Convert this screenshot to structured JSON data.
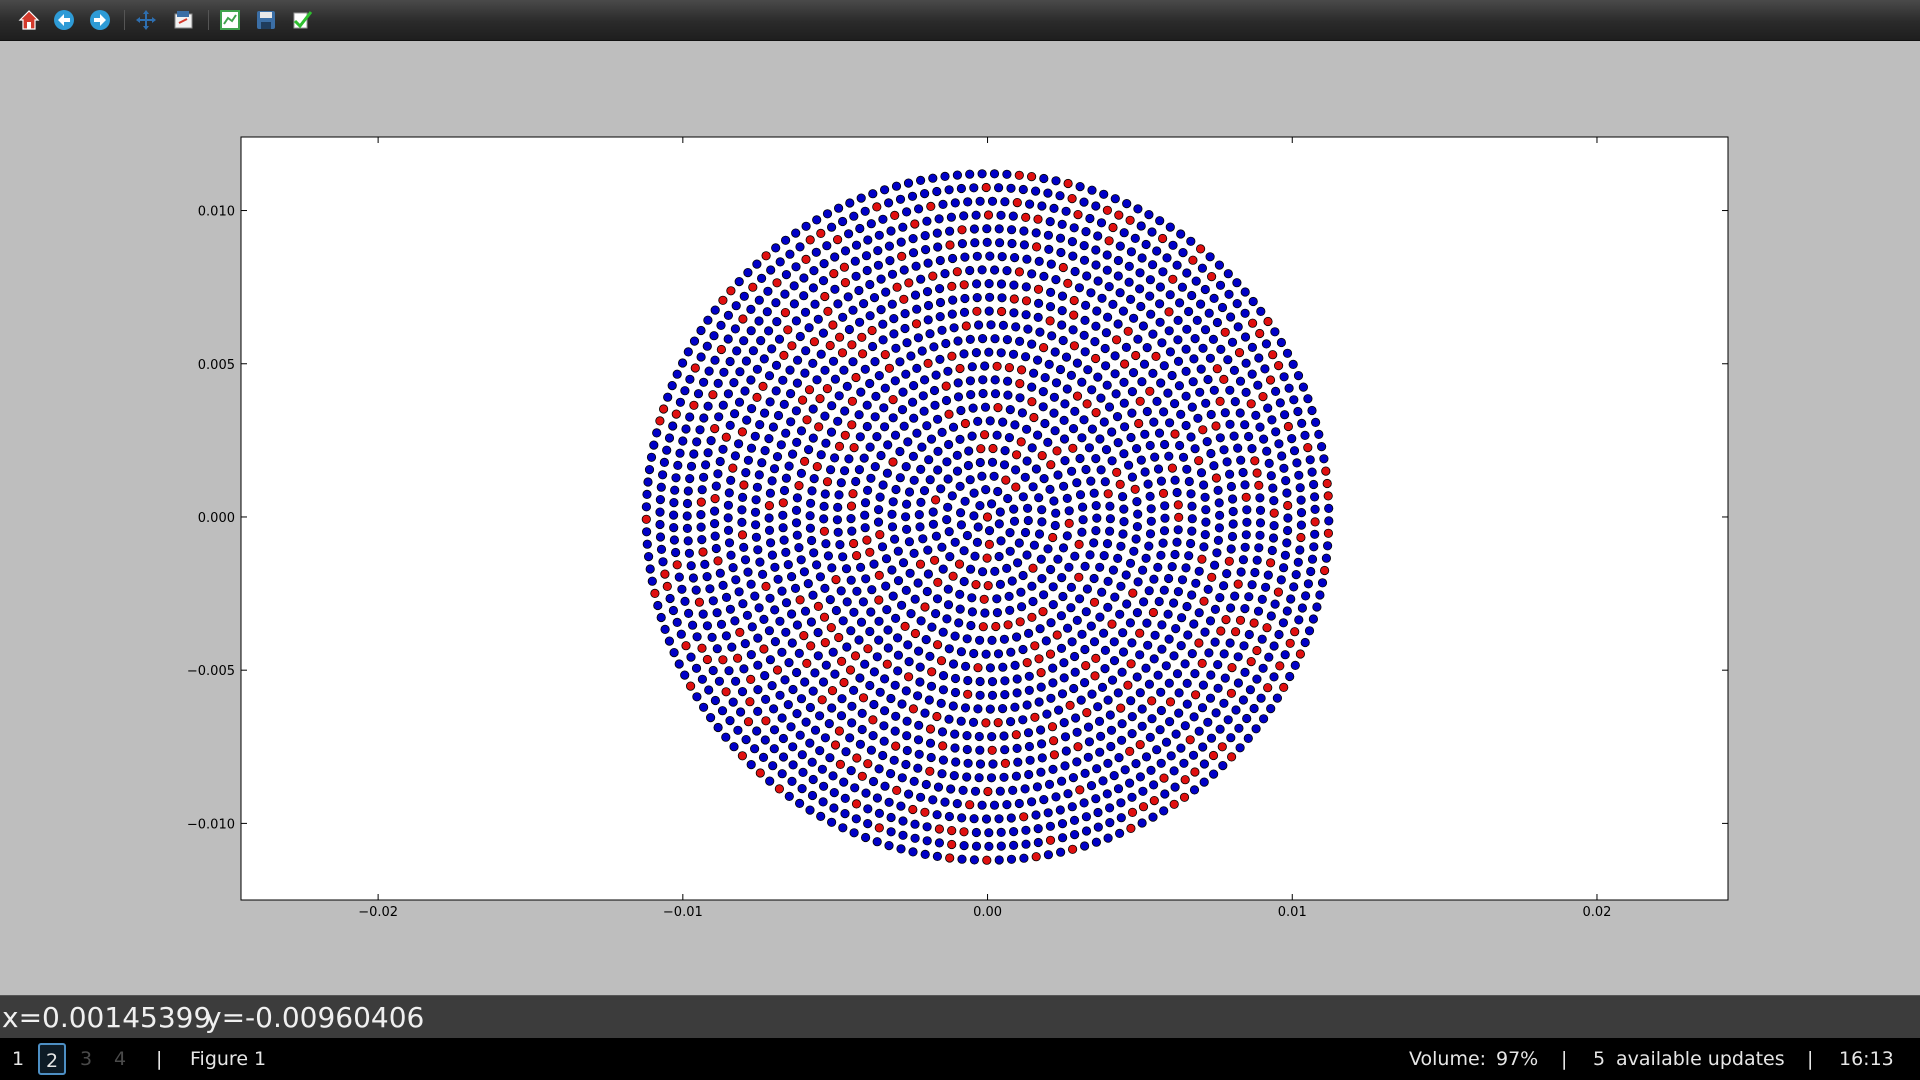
{
  "toolbar": {
    "buttons": [
      {
        "name": "home-icon",
        "color": "#d33a2c"
      },
      {
        "name": "back-arrow-icon",
        "color": "#2e9bd6"
      },
      {
        "name": "forward-arrow-icon",
        "color": "#2e9bd6"
      },
      {
        "name": "pan-icon",
        "color": "#2e6fb0"
      },
      {
        "name": "zoom-to-rect-icon",
        "color": "#e0e0e0"
      },
      {
        "name": "configure-subplots-icon",
        "color": "#3fa34d"
      },
      {
        "name": "save-icon",
        "color": "#3b6ea5"
      },
      {
        "name": "edit-check-icon",
        "color": "#2fbf2f"
      }
    ]
  },
  "chart_data": {
    "type": "scatter",
    "title": "",
    "xlabel": "",
    "ylabel": "",
    "xlim": [
      -0.0245,
      0.0243
    ],
    "ylim": [
      -0.0125,
      0.0124
    ],
    "x_ticks": [
      "−0.02",
      "−0.01",
      "0.00",
      "0.01",
      "0.02"
    ],
    "y_ticks": [
      "0.010",
      "0.005",
      "0.000",
      "−0.005",
      "−0.010"
    ],
    "x_tick_values": [
      -0.02,
      -0.01,
      0.0,
      0.01,
      0.02
    ],
    "y_tick_values": [
      0.01,
      0.005,
      0.0,
      -0.005,
      -0.01
    ],
    "grid": false,
    "series": [
      {
        "marker_color": "#0000c8",
        "values_note": null
      },
      {
        "marker_color": "#e01010",
        "values_note": null
      }
    ],
    "disk_radius": 0.0112,
    "approx_point_count": 2200
  },
  "coords": {
    "x": "x=0.00145399",
    "y": "y=-0.00960406"
  },
  "taskbar": {
    "workspaces": [
      "1",
      "2",
      "3",
      "4"
    ],
    "active_workspace": "2",
    "separator": "|",
    "window_title": "Figure 1",
    "volume_label": "Volume:",
    "volume_value": "97%",
    "updates_count": "5",
    "updates_label": "available updates",
    "time": "16:13"
  }
}
